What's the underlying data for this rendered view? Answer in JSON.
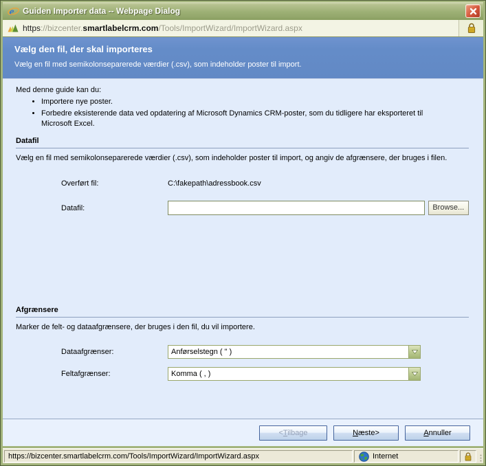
{
  "window": {
    "title": "Guiden Importer data -- Webpage Dialog"
  },
  "address_bar": {
    "url_scheme": "https",
    "url_separator": "://bizcenter.",
    "url_domain": "smartlabelcrm.com",
    "url_path": "/Tools/ImportWizard/ImportWizard.aspx"
  },
  "header": {
    "title": "Vælg den fil, der skal importeres",
    "subtitle": "Vælg en fil med semikolonseparerede værdier (.csv), som indeholder poster til import."
  },
  "intro": {
    "lead": "Med denne guide kan du:",
    "bullets": [
      "Importere nye poster.",
      "Forbedre eksisterende data ved opdatering af Microsoft Dynamics CRM-poster, som du tidligere har eksporteret til Microsoft Excel."
    ]
  },
  "datafil_section": {
    "title": "Datafil",
    "description": "Vælg en fil med semikolonseparerede værdier (.csv), som indeholder poster til import, og angiv de afgrænsere, der bruges i filen.",
    "uploaded_label": "Overført fil:",
    "uploaded_value": "C:\\fakepath\\adressbook.csv",
    "file_label": "Datafil:",
    "file_input_value": "",
    "browse_label": "Browse..."
  },
  "delimiters_section": {
    "title": "Afgrænsere",
    "description": "Marker de felt- og dataafgrænsere, der bruges i den fil, du vil importere.",
    "data_delimiter_label": "Dataafgrænser:",
    "data_delimiter_value": "Anførselstegn ( \" )",
    "field_delimiter_label": "Feltafgrænser:",
    "field_delimiter_value": "Komma ( , )"
  },
  "footer": {
    "back": {
      "pre": "<",
      "u": "T",
      "post": "ilbage"
    },
    "next": {
      "pre": "",
      "u": "N",
      "post": "æste>"
    },
    "cancel": {
      "pre": "",
      "u": "A",
      "post": "nnuller"
    }
  },
  "status_bar": {
    "url": "https://bizcenter.smartlabelcrm.com/Tools/ImportWizard/ImportWizard.aspx",
    "zone": "Internet"
  },
  "colors": {
    "frame_olive": "#a3b47c",
    "header_blue": "#648cc8",
    "content_bg": "#e2ecfb",
    "statusbar_bg": "#ece9d8",
    "close_red": "#d4563b"
  }
}
